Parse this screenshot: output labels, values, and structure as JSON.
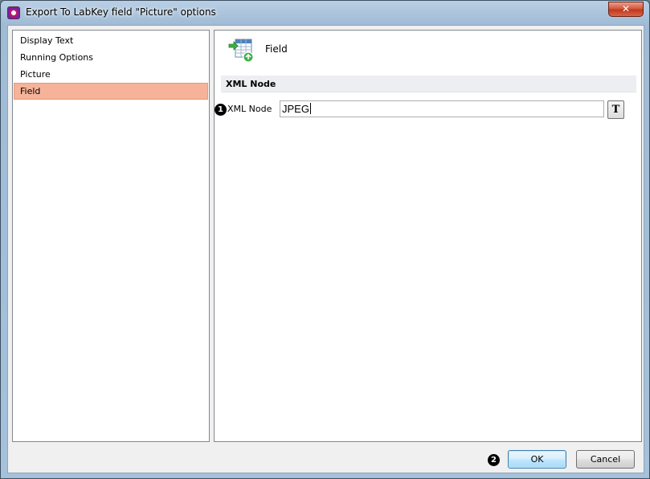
{
  "window": {
    "title": "Export To LabKey field \"Picture\" options",
    "close_label": "✕"
  },
  "sidebar": {
    "items": [
      {
        "label": "Display Text",
        "selected": false
      },
      {
        "label": "Running Options",
        "selected": false
      },
      {
        "label": "Picture",
        "selected": false
      },
      {
        "label": "Field",
        "selected": true
      }
    ]
  },
  "main": {
    "header_title": "Field",
    "header_icon": "table-field-icon",
    "section_title": "XML Node",
    "xml_node": {
      "badge": "1",
      "label": "XML Node",
      "value": "JPEG",
      "format_button_label": "T"
    }
  },
  "footer": {
    "badge": "2",
    "ok_label": "OK",
    "cancel_label": "Cancel"
  },
  "colors": {
    "selected_item_bg": "#f7b399",
    "close_button": "#c0391e",
    "section_header_bg": "#eceef2"
  }
}
